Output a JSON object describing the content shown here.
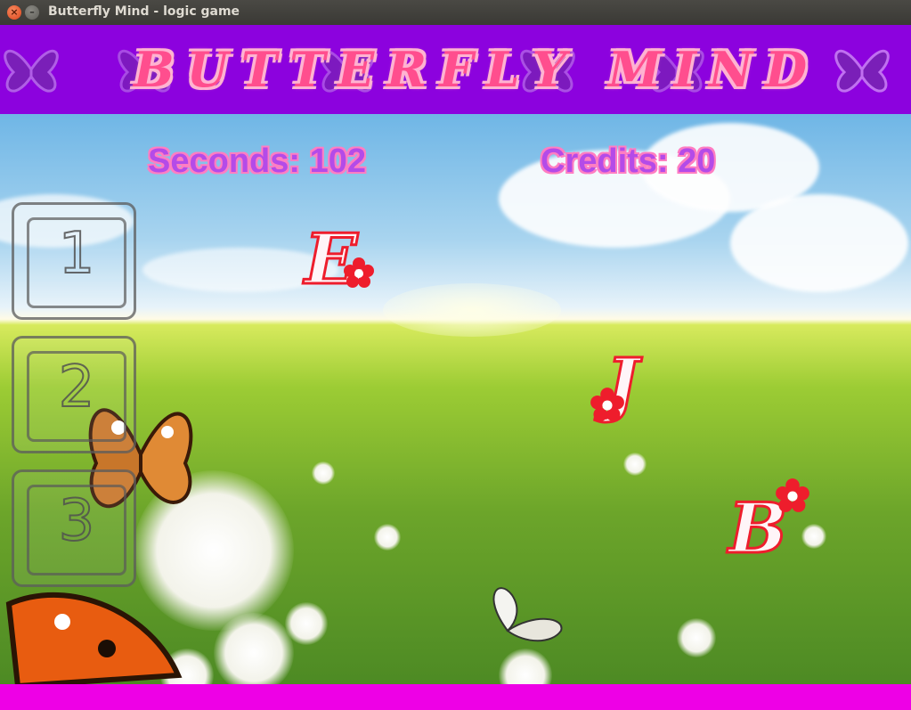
{
  "window": {
    "title": "Butterfly Mind - logic game",
    "close_glyph": "×",
    "minimize_glyph": "–"
  },
  "banner": {
    "logo_letters": [
      "B",
      "U",
      "T",
      "T",
      "E",
      "R",
      "F",
      "L",
      "Y",
      " ",
      "M",
      "I",
      "N",
      "D"
    ],
    "color": "#8c02de"
  },
  "hud": {
    "seconds": "Seconds: 102",
    "credits": "Credits: 20"
  },
  "buttons": [
    {
      "label": "1"
    },
    {
      "label": "2"
    },
    {
      "label": "3"
    }
  ],
  "letters": [
    {
      "char": "E"
    },
    {
      "char": "J"
    },
    {
      "char": "B"
    }
  ],
  "colors": {
    "hud_text": "#b44be8",
    "hud_outline": "#ff7ec2",
    "letter_outline": "#ee1d2c",
    "bottom_bar": "#ee00e6"
  },
  "icons": [
    "butterfly-icon",
    "flower-icon"
  ]
}
